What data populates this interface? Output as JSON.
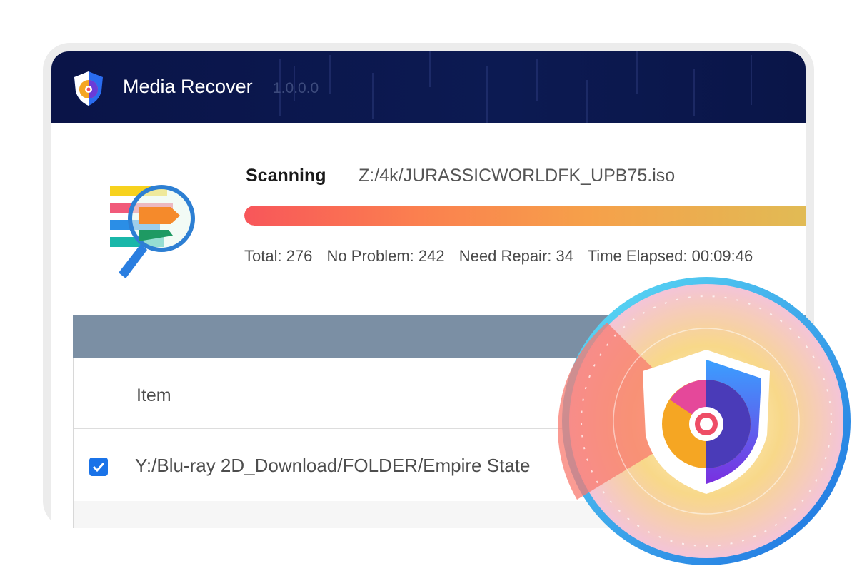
{
  "app": {
    "name": "Media Recover",
    "version": "1.0.0.0"
  },
  "scan": {
    "label": "Scanning",
    "path": "Z:/4k/JURASSICWORLDFK_UPB75.iso",
    "progress_percent": 100,
    "progress_colors": [
      "#f8565a",
      "#fb7f4f",
      "#f6a04a",
      "#e0bc55"
    ]
  },
  "stats": {
    "total": "Total: 276",
    "no_problem": "No Problem: 242",
    "need_repair": "Need Repair: 34",
    "time_elapsed": "Time Elapsed: 00:09:46"
  },
  "table": {
    "column_header": "Item",
    "rows": [
      {
        "checked": true,
        "path": "Y:/Blu-ray 2D_Download/FOLDER/Empire State"
      }
    ]
  },
  "icons": {
    "app_logo": "shield-disc-icon",
    "scan": "magnifier-scan-icon",
    "badge": "shield-disc-badge-icon",
    "checkbox": "checkmark-icon"
  },
  "colors": {
    "titlebar": "#0a1448",
    "table_header": "#7b8fa4",
    "checkbox": "#1a73e8"
  }
}
